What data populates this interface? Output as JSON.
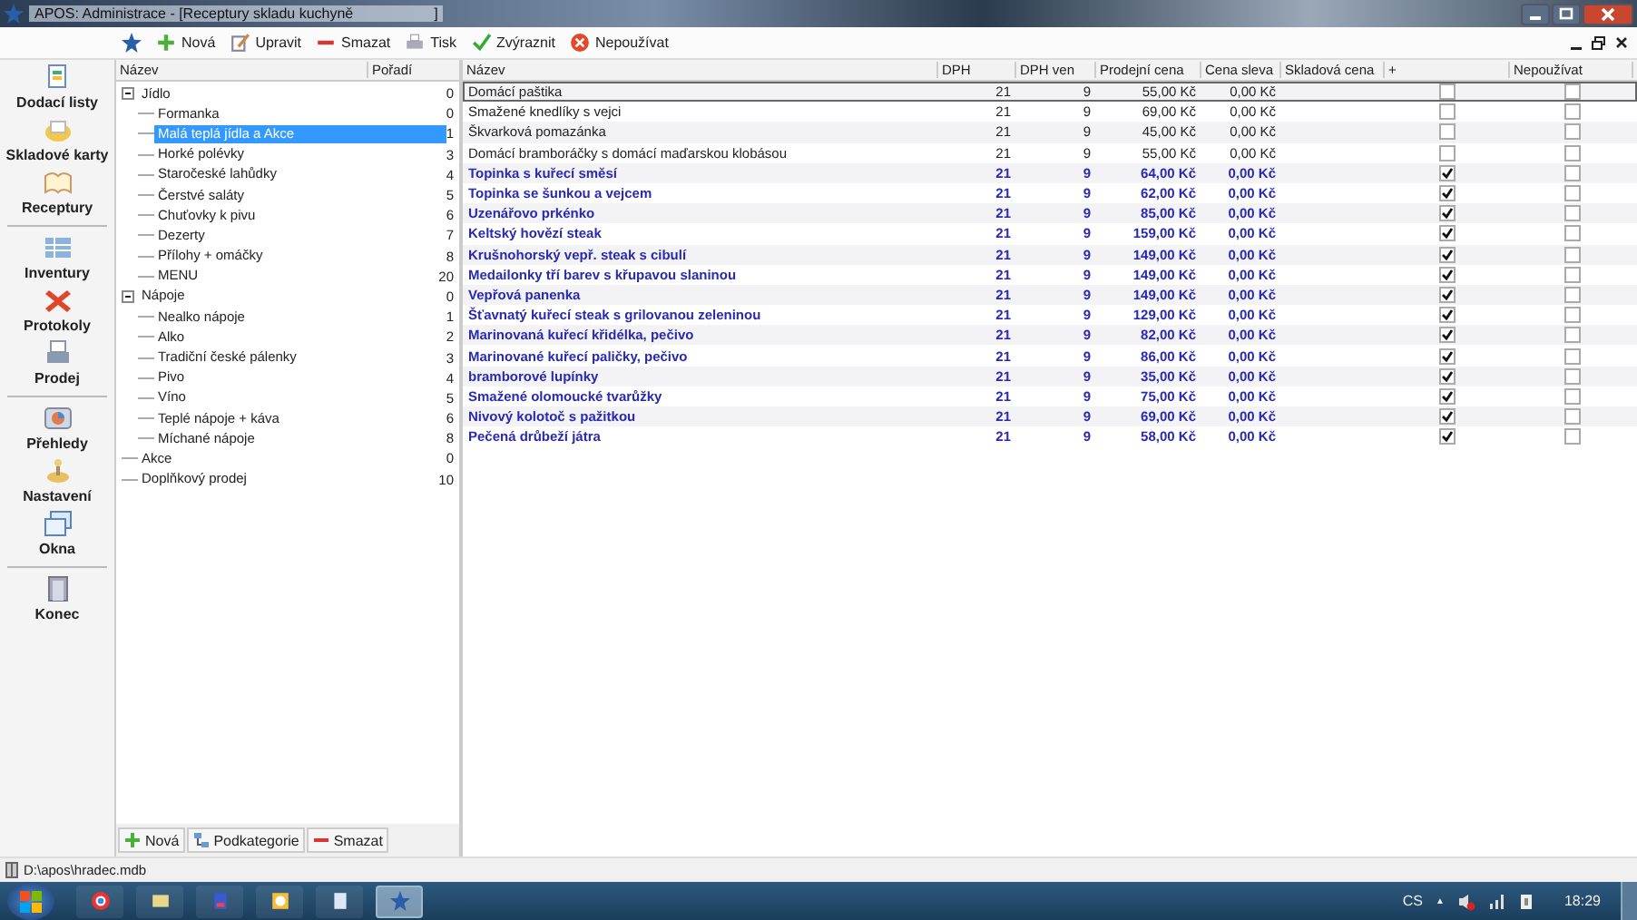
{
  "window": {
    "title": "APOS: Administrace - [Receptury skladu kuchyně                    ]"
  },
  "toolbar": [
    {
      "kind": "star"
    },
    {
      "kind": "plus",
      "label": "Nová"
    },
    {
      "kind": "edit",
      "label": "Upravit"
    },
    {
      "kind": "minus",
      "label": "Smazat"
    },
    {
      "kind": "print",
      "label": "Tisk"
    },
    {
      "kind": "check",
      "label": "Zvýraznit"
    },
    {
      "kind": "stop",
      "label": "Nepoužívat"
    }
  ],
  "sidebar": {
    "items": [
      {
        "label": "Dodací listy",
        "kind": "doc",
        "separator_after": false
      },
      {
        "label": "Skladové karty",
        "kind": "box",
        "separator_after": false
      },
      {
        "label": "Receptury",
        "kind": "book",
        "separator_after": true
      },
      {
        "label": "Inventury",
        "kind": "grid",
        "separator_after": false
      },
      {
        "label": "Protokoly",
        "kind": "cross",
        "separator_after": false
      },
      {
        "label": "Prodej",
        "kind": "print",
        "separator_after": true
      },
      {
        "label": "Přehledy",
        "kind": "chart",
        "separator_after": false
      },
      {
        "label": "Nastavení",
        "kind": "gear",
        "separator_after": false
      },
      {
        "label": "Okna",
        "kind": "windows",
        "separator_after": true
      },
      {
        "label": "Konec",
        "kind": "exit",
        "separator_after": false
      }
    ]
  },
  "tree": {
    "columns": [
      "Název",
      "Pořadí"
    ],
    "items": [
      {
        "label": "Jídlo",
        "order": "0",
        "selected": false,
        "expanded": true,
        "children": [
          {
            "label": "Formanka",
            "order": "0",
            "selected": false
          },
          {
            "label": "Malá teplá jídla a Akce",
            "order": "1",
            "selected": true
          },
          {
            "label": "Horké polévky",
            "order": "3",
            "selected": false
          },
          {
            "label": "Staročeské lahůdky",
            "order": "4",
            "selected": false
          },
          {
            "label": "Čerstvé saláty",
            "order": "5",
            "selected": false
          },
          {
            "label": "Chuťovky k pivu",
            "order": "6",
            "selected": false
          },
          {
            "label": "Dezerty",
            "order": "7",
            "selected": false
          },
          {
            "label": "Přílohy + omáčky",
            "order": "8",
            "selected": false
          },
          {
            "label": "MENU",
            "order": "20",
            "selected": false
          }
        ]
      },
      {
        "label": "Nápoje",
        "order": "0",
        "selected": false,
        "expanded": true,
        "children": [
          {
            "label": "Nealko nápoje",
            "order": "1",
            "selected": false
          },
          {
            "label": "Alko",
            "order": "2",
            "selected": false
          },
          {
            "label": "Tradiční české pálenky",
            "order": "3",
            "selected": false
          },
          {
            "label": "Pivo",
            "order": "4",
            "selected": false
          },
          {
            "label": "Víno",
            "order": "5",
            "selected": false
          },
          {
            "label": "Teplé nápoje + káva",
            "order": "6",
            "selected": false
          },
          {
            "label": "Míchané nápoje",
            "order": "8",
            "selected": false
          }
        ]
      },
      {
        "label": "Akce",
        "order": "0",
        "selected": false
      },
      {
        "label": "Doplňkový prodej",
        "order": "10",
        "selected": false
      }
    ],
    "buttons": [
      {
        "kind": "plus",
        "label": "Nová"
      },
      {
        "kind": "sub",
        "label": "Podkategorie"
      },
      {
        "kind": "minus",
        "label": "Smazat"
      }
    ]
  },
  "table": {
    "columns": [
      "Název",
      "DPH",
      "DPH ven",
      "Prodejní cena",
      "Cena sleva",
      "Skladová cena",
      "+",
      "Nepoužívat"
    ],
    "rows": [
      {
        "name": "Domácí paštika",
        "dph": "21",
        "dph_ven": "9",
        "price": "55,00 Kč",
        "discount": "0,00 Kč",
        "highlighted": false,
        "plus": false,
        "unused": false,
        "selected": true
      },
      {
        "name": "Smažené knedlíky s vejci",
        "dph": "21",
        "dph_ven": "9",
        "price": "69,00 Kč",
        "discount": "0,00 Kč",
        "highlighted": false,
        "plus": false,
        "unused": false,
        "selected": false
      },
      {
        "name": "Škvarková pomazánka",
        "dph": "21",
        "dph_ven": "9",
        "price": "45,00 Kč",
        "discount": "0,00 Kč",
        "highlighted": false,
        "plus": false,
        "unused": false,
        "selected": false
      },
      {
        "name": "Domácí bramboráčky s domácí maďarskou klobásou",
        "dph": "21",
        "dph_ven": "9",
        "price": "55,00 Kč",
        "discount": "0,00 Kč",
        "highlighted": false,
        "plus": false,
        "unused": false,
        "selected": false
      },
      {
        "name": "Topinka s kuřecí směsí",
        "dph": "21",
        "dph_ven": "9",
        "price": "64,00 Kč",
        "discount": "0,00 Kč",
        "highlighted": true,
        "plus": true,
        "unused": false,
        "selected": false
      },
      {
        "name": "Topinka se šunkou a vejcem",
        "dph": "21",
        "dph_ven": "9",
        "price": "62,00 Kč",
        "discount": "0,00 Kč",
        "highlighted": true,
        "plus": true,
        "unused": false,
        "selected": false
      },
      {
        "name": "Uzenářovo prkénko",
        "dph": "21",
        "dph_ven": "9",
        "price": "85,00 Kč",
        "discount": "0,00 Kč",
        "highlighted": true,
        "plus": true,
        "unused": false,
        "selected": false
      },
      {
        "name": "Keltský hovězí steak",
        "dph": "21",
        "dph_ven": "9",
        "price": "159,00 Kč",
        "discount": "0,00 Kč",
        "highlighted": true,
        "plus": true,
        "unused": false,
        "selected": false
      },
      {
        "name": "Krušnohorský vepř. steak s cibulí",
        "dph": "21",
        "dph_ven": "9",
        "price": "149,00 Kč",
        "discount": "0,00 Kč",
        "highlighted": true,
        "plus": true,
        "unused": false,
        "selected": false
      },
      {
        "name": "Medailonky tří barev s křupavou slaninou",
        "dph": "21",
        "dph_ven": "9",
        "price": "149,00 Kč",
        "discount": "0,00 Kč",
        "highlighted": true,
        "plus": true,
        "unused": false,
        "selected": false
      },
      {
        "name": "Vepřová panenka",
        "dph": "21",
        "dph_ven": "9",
        "price": "149,00 Kč",
        "discount": "0,00 Kč",
        "highlighted": true,
        "plus": true,
        "unused": false,
        "selected": false
      },
      {
        "name": "Šťavnatý kuřecí steak s grilovanou zeleninou",
        "dph": "21",
        "dph_ven": "9",
        "price": "129,00 Kč",
        "discount": "0,00 Kč",
        "highlighted": true,
        "plus": true,
        "unused": false,
        "selected": false
      },
      {
        "name": "Marinovaná kuřecí křidélka, pečivo",
        "dph": "21",
        "dph_ven": "9",
        "price": "82,00 Kč",
        "discount": "0,00 Kč",
        "highlighted": true,
        "plus": true,
        "unused": false,
        "selected": false
      },
      {
        "name": "Marinované kuřecí paličky, pečivo",
        "dph": "21",
        "dph_ven": "9",
        "price": "86,00 Kč",
        "discount": "0,00 Kč",
        "highlighted": true,
        "plus": true,
        "unused": false,
        "selected": false
      },
      {
        "name": "bramborové lupínky",
        "dph": "21",
        "dph_ven": "9",
        "price": "35,00 Kč",
        "discount": "0,00 Kč",
        "highlighted": true,
        "plus": true,
        "unused": false,
        "selected": false
      },
      {
        "name": "Smažené olomoucké tvarůžky",
        "dph": "21",
        "dph_ven": "9",
        "price": "75,00 Kč",
        "discount": "0,00 Kč",
        "highlighted": true,
        "plus": true,
        "unused": false,
        "selected": false
      },
      {
        "name": "Nivový kolotoč s pažitkou",
        "dph": "21",
        "dph_ven": "9",
        "price": "69,00 Kč",
        "discount": "0,00 Kč",
        "highlighted": true,
        "plus": true,
        "unused": false,
        "selected": false
      },
      {
        "name": "Pečená drůbeží játra",
        "dph": "21",
        "dph_ven": "9",
        "price": "58,00 Kč",
        "discount": "0,00 Kč",
        "highlighted": true,
        "plus": true,
        "unused": false,
        "selected": false
      }
    ]
  },
  "status_bar": {
    "path": "D:\\apos\\hradec.mdb"
  },
  "taskbar": {
    "apps": [
      {
        "kind": "browser",
        "active": false
      },
      {
        "kind": "folder",
        "active": false
      },
      {
        "kind": "disk",
        "active": false
      },
      {
        "kind": "clock",
        "active": false
      },
      {
        "kind": "page",
        "active": false
      },
      {
        "kind": "star",
        "active": true
      }
    ],
    "language": "CS",
    "tray_arrow": "▲",
    "time": "18:29"
  }
}
